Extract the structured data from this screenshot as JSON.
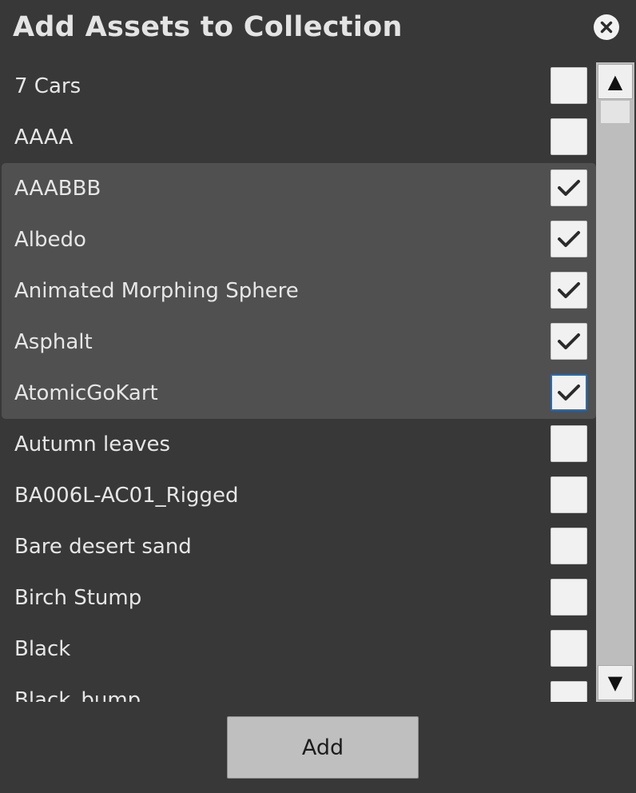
{
  "dialog": {
    "title": "Add Assets to Collection",
    "close_icon": "close-icon",
    "add_label": "Add"
  },
  "colors": {
    "background": "#383838",
    "selected_row": "#505050",
    "checkbox_focus": "#2a6cb3"
  },
  "assets": [
    {
      "name": "7 Cars",
      "checked": false
    },
    {
      "name": "AAAA",
      "checked": false
    },
    {
      "name": "AAABBB",
      "checked": true
    },
    {
      "name": "Albedo",
      "checked": true
    },
    {
      "name": "Animated Morphing Sphere",
      "checked": true
    },
    {
      "name": "Asphalt",
      "checked": true
    },
    {
      "name": "AtomicGoKart",
      "checked": true,
      "focused": true
    },
    {
      "name": "Autumn leaves",
      "checked": false
    },
    {
      "name": "BA006L-AC01_Rigged",
      "checked": false
    },
    {
      "name": "Bare desert sand",
      "checked": false
    },
    {
      "name": "Birch Stump",
      "checked": false
    },
    {
      "name": "Black",
      "checked": false
    },
    {
      "name": "Black_bump",
      "checked": false
    }
  ],
  "scrollbar": {
    "up_icon": "arrow-up-icon",
    "down_icon": "arrow-down-icon",
    "up_glyph": "▲",
    "down_glyph": "▼"
  }
}
